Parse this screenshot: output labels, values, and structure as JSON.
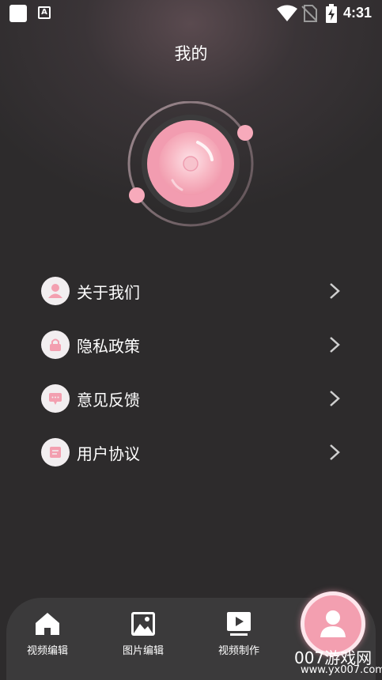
{
  "status_bar": {
    "time": "4:31",
    "a_glyph": "A",
    "icons": [
      "app-square-icon",
      "a-notification-icon",
      "wifi-icon",
      "no-sim-icon",
      "battery-charging-icon"
    ]
  },
  "header": {
    "title": "我的"
  },
  "menu": {
    "items": [
      {
        "label": "关于我们",
        "icon": "person-icon"
      },
      {
        "label": "隐私政策",
        "icon": "lock-icon"
      },
      {
        "label": "意见反馈",
        "icon": "chat-bubble-icon"
      },
      {
        "label": "用户协议",
        "icon": "document-icon"
      }
    ]
  },
  "bottom_nav": {
    "items": [
      {
        "label": "视频编辑",
        "icon": "home-icon"
      },
      {
        "label": "图片编辑",
        "icon": "image-icon"
      },
      {
        "label": "视频制作",
        "icon": "video-play-icon"
      },
      {
        "label": "",
        "icon": "profile-icon",
        "active": true
      }
    ]
  },
  "watermark": {
    "text": "007游戏网",
    "url": "www.yx007.com"
  },
  "colors": {
    "background": "#2d2b2c",
    "accent_pink": "#f39fb0",
    "icon_circle": "#f2eef0",
    "nav_bg": "#3b3a3b"
  }
}
